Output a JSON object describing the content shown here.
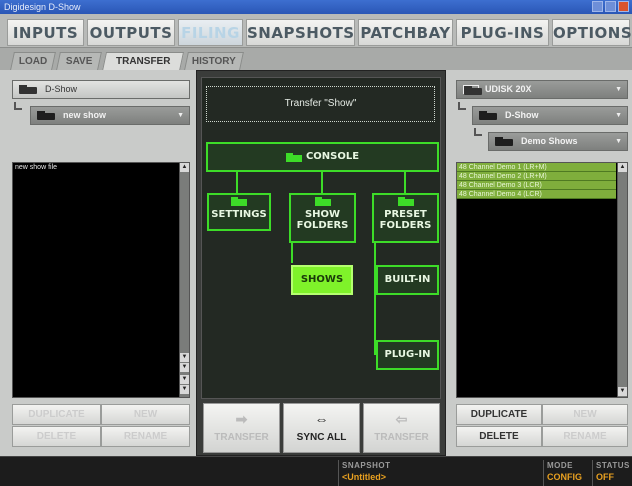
{
  "window": {
    "title": "Digidesign D-Show"
  },
  "main_tabs": [
    "INPUTS",
    "OUTPUTS",
    "FILING",
    "SNAPSHOTS",
    "PATCHBAY",
    "PLUG-INS",
    "OPTIONS"
  ],
  "active_main_tab": "FILING",
  "sub_tabs": [
    "LOAD",
    "SAVE",
    "TRANSFER",
    "HISTORY"
  ],
  "active_sub_tab": "TRANSFER",
  "left": {
    "location": "D-Show",
    "folder": "new show",
    "files": [
      "new show file"
    ],
    "buttons": {
      "duplicate": "DUPLICATE",
      "new": "NEW",
      "delete": "DELETE",
      "rename": "RENAME"
    }
  },
  "center": {
    "transfer_title": "Transfer \"Show\"",
    "tree": {
      "console": "CONSOLE",
      "settings": "SETTINGS",
      "show_folders_1": "SHOW",
      "show_folders_2": "FOLDERS",
      "preset_folders_1": "PRESET",
      "preset_folders_2": "FOLDERS",
      "shows": "SHOWS",
      "built_in": "BUILT-IN",
      "plug_in": "PLUG-IN"
    },
    "buttons": {
      "transfer_left": "TRANSFER",
      "sync_all": "SYNC ALL",
      "transfer_right": "TRANSFER"
    }
  },
  "right": {
    "drive": "UDISK 20X",
    "folder": "D-Show",
    "subfolder": "Demo Shows",
    "files": [
      "48 Channel Demo 1 (LR+M)",
      "48 Channel Demo 2 (LR+M)",
      "48 Channel Demo 3 (LCR)",
      "48 Channel Demo 4 (LCR)"
    ],
    "buttons": {
      "duplicate": "DUPLICATE",
      "new": "NEW",
      "delete": "DELETE",
      "rename": "RENAME"
    }
  },
  "status": {
    "snapshot_label": "SNAPSHOT",
    "snapshot_value": "<Untitled>",
    "mode_label": "MODE",
    "mode_value": "CONFIG",
    "status_label": "STATUS",
    "status_value": "OFF"
  }
}
